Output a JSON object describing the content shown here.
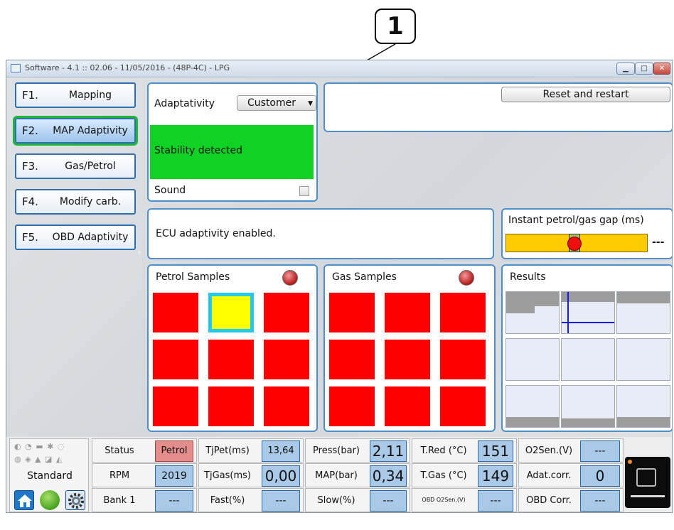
{
  "callout": "1",
  "window": {
    "title": "Software - 4.1 :: 02.06 - 11/05/2016 - (48P-4C) - LPG",
    "controls": [
      "▁",
      "□",
      "✕"
    ]
  },
  "nav": [
    {
      "key": "F1.",
      "label": "Mapping"
    },
    {
      "key": "F2.",
      "label": "MAP Adaptivity"
    },
    {
      "key": "F3.",
      "label": "Gas/Petrol"
    },
    {
      "key": "F4.",
      "label": "Modify carb."
    },
    {
      "key": "F5.",
      "label": "OBD Adaptivity"
    }
  ],
  "adaptivity": {
    "label": "Adaptativity",
    "selected": "Customer",
    "stability": "Stability detected",
    "sound_label": "Sound"
  },
  "reset_label": "Reset and restart",
  "ecu_message": "ECU adaptivity enabled.",
  "gap": {
    "title": "Instant petrol/gas gap (ms)",
    "value": "---"
  },
  "petrol_samples": "Petrol Samples",
  "gas_samples": "Gas Samples",
  "results": "Results",
  "bottom": {
    "mode": "Standard",
    "rows": [
      [
        {
          "label": "Status",
          "value": "Petrol"
        },
        {
          "label": "TjPet(ms)",
          "value": "13,64"
        },
        {
          "label": "Press(bar)",
          "value": "2,11"
        },
        {
          "label": "T.Red (°C)",
          "value": "151"
        },
        {
          "label": "O2Sen.(V)",
          "value": "---"
        }
      ],
      [
        {
          "label": "RPM",
          "value": "2019"
        },
        {
          "label": "TjGas(ms)",
          "value": "0,00"
        },
        {
          "label": "MAP(bar)",
          "value": "0,34"
        },
        {
          "label": "T.Gas (°C)",
          "value": "149"
        },
        {
          "label": "Adat.corr.",
          "value": "0"
        }
      ],
      [
        {
          "label": "Bank 1",
          "value": "---"
        },
        {
          "label": "Fast(%)",
          "value": "---"
        },
        {
          "label": "Slow(%)",
          "value": "---"
        },
        {
          "label": "OBD O2Sen.(V)",
          "value": "---"
        },
        {
          "label": "OBD Corr.",
          "value": "---"
        }
      ]
    ]
  }
}
